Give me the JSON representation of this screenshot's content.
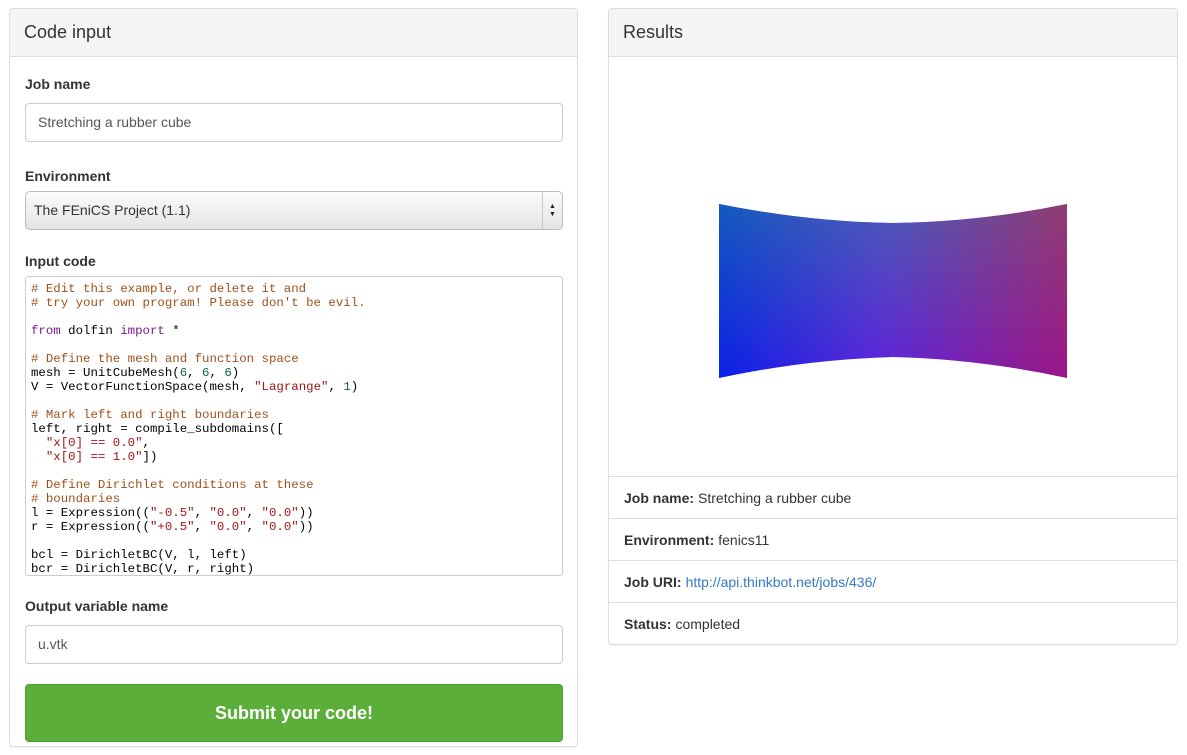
{
  "code_panel": {
    "title": "Code input",
    "job_name_label": "Job name",
    "job_name_value": "Stretching a rubber cube",
    "environment_label": "Environment",
    "environment_selected": "The FEniCS Project (1.1)",
    "input_code_label": "Input code",
    "code_lines": [
      "# Edit this example, or delete it and",
      "# try your own program! Please don't be evil.",
      "",
      "from dolfin import *",
      "",
      "# Define the mesh and function space",
      "mesh = UnitCubeMesh(6, 6, 6)",
      "V = VectorFunctionSpace(mesh, \"Lagrange\", 1)",
      "",
      "# Mark left and right boundaries",
      "left, right = compile_subdomains([",
      "  \"x[0] == 0.0\",",
      "  \"x[0] == 1.0\"])",
      "",
      "# Define Dirichlet conditions at these",
      "# boundaries",
      "l = Expression((\"-0.5\", \"0.0\", \"0.0\"))",
      "r = Expression((\"+0.5\", \"0.0\", \"0.0\"))",
      "",
      "bcl = DirichletBC(V, l, left)",
      "bcr = DirichletBC(V, r, right)"
    ],
    "output_label": "Output variable name",
    "output_value": "u.vtk",
    "submit_label": "Submit your code!"
  },
  "results_panel": {
    "title": "Results",
    "rows": [
      {
        "key": "Job name:",
        "value": "Stretching a rubber cube"
      },
      {
        "key": "Environment:",
        "value": "fenics11"
      },
      {
        "key": "Job URI:",
        "value": "http://api.thinkbot.net/jobs/436/"
      },
      {
        "key": "Status:",
        "value": "completed"
      }
    ]
  },
  "colors": {
    "submit_green": "#5cae3a",
    "link_blue": "#3479c6",
    "panel_heading_bg": "#f5f5f5",
    "border": "#dddddd"
  }
}
